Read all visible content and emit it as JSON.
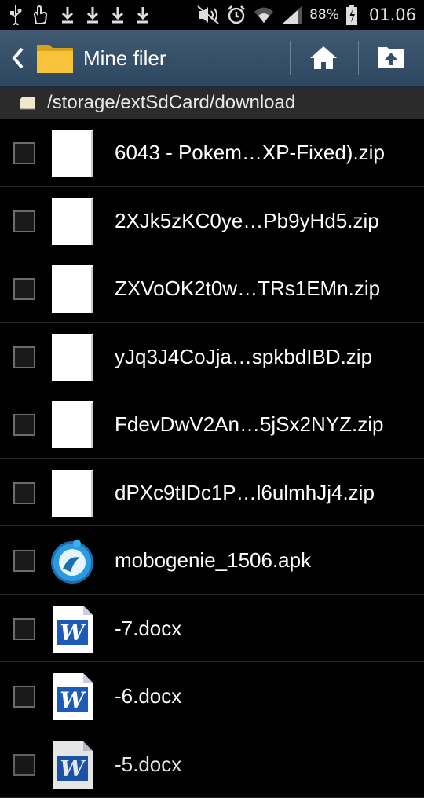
{
  "status_bar": {
    "battery": "88%",
    "time": "01.06",
    "left_icons": [
      "usb-icon",
      "hand-icon",
      "download-icon",
      "download-icon",
      "download-icon",
      "download-icon"
    ],
    "right_icons": [
      "mute-icon",
      "alarm-icon",
      "wifi-icon",
      "signal-icon",
      "battery-icon"
    ]
  },
  "action_bar": {
    "title": "Mine filer",
    "icons": [
      "back-icon",
      "folder-icon",
      "home-icon",
      "up-folder-icon"
    ],
    "color": "#36506a"
  },
  "path_bar": {
    "path": "/storage/extSdCard/download"
  },
  "files": [
    {
      "name": "6043 - Pokem…XP-Fixed).zip",
      "icon": "zip-file-icon"
    },
    {
      "name": "2XJk5zKC0ye…Pb9yHd5.zip",
      "icon": "zip-file-icon"
    },
    {
      "name": "ZXVoOK2t0w…TRs1EMn.zip",
      "icon": "zip-file-icon"
    },
    {
      "name": "yJq3J4CoJja…spkbdIBD.zip",
      "icon": "zip-file-icon"
    },
    {
      "name": "FdevDwV2An…5jSx2NYZ.zip",
      "icon": "zip-file-icon"
    },
    {
      "name": "dPXc9tIDc1P…l6ulmhJj4.zip",
      "icon": "zip-file-icon"
    },
    {
      "name": "mobogenie_1506.apk",
      "icon": "mobogenie-apk-icon"
    },
    {
      "name": "-7.docx",
      "icon": "word-doc-icon"
    },
    {
      "name": "-6.docx",
      "icon": "word-doc-icon"
    },
    {
      "name": "-5.docx",
      "icon": "word-doc-icon"
    }
  ]
}
